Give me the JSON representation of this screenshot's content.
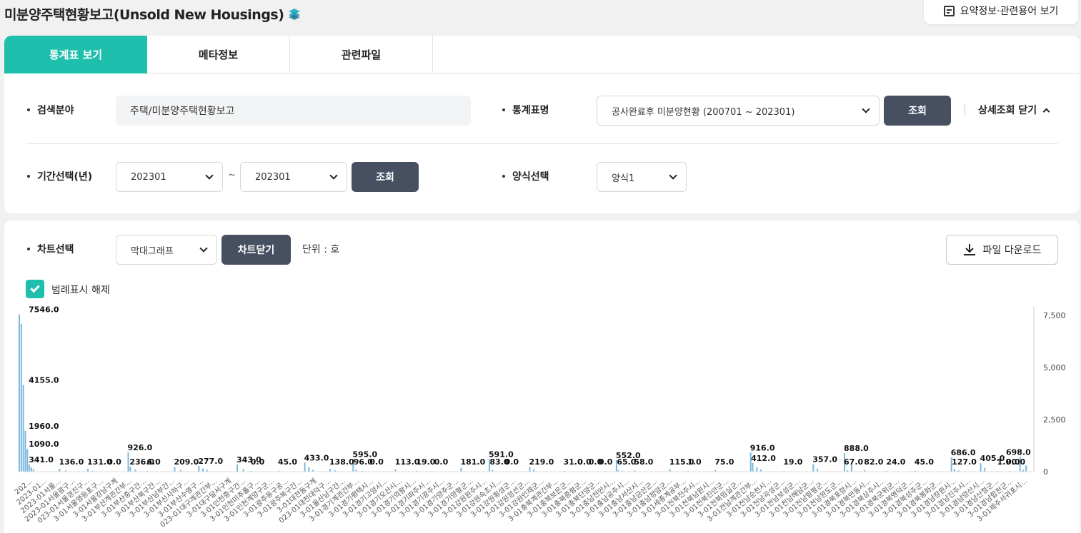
{
  "page": {
    "title": "미분양주택현황보고(Unsold New Housings)",
    "summary_button": "요약정보·관련용어 보기"
  },
  "tabs": [
    {
      "label": "통계표 보기",
      "active": true
    },
    {
      "label": "메타정보",
      "active": false
    },
    {
      "label": "관련파일",
      "active": false
    }
  ],
  "search": {
    "field_label": "검색분야",
    "field_value": "주택/미분양주택현황보고",
    "table_label": "통계표명",
    "table_value": "공사완료후 미분양현황 (200701 ~ 202301)",
    "query_button": "조회",
    "detail_toggle": "상세조회 닫기",
    "period_label": "기간선택(년)",
    "period_from": "202301",
    "period_sep": "~",
    "period_to": "202301",
    "period_query_button": "조회",
    "format_label": "양식선택",
    "format_value": "양식1"
  },
  "chart_controls": {
    "chart_label": "차트선택",
    "chart_type_value": "막대그래프",
    "close_chart_button": "차트닫기",
    "unit": "단위 : 호",
    "download_button": "파일 다운로드",
    "legend_checkbox_label": "범례표시 해제",
    "legend_checked": true
  },
  "colors": {
    "accent": "#1fbfad",
    "dark_button": "#475061",
    "bar": "#7ab8e0"
  },
  "chart_data": {
    "type": "bar",
    "y_ticks": [
      "7,500",
      "5,000",
      "2,500",
      "0"
    ],
    "ylim": [
      0,
      7500
    ],
    "y_axis_side": "right",
    "grid": false,
    "bar_labels": [
      {
        "x": 0.01,
        "text": "7546.0",
        "value": 7546
      },
      {
        "x": 0.01,
        "text": "4155.0",
        "value": 4155
      },
      {
        "x": 0.01,
        "text": "1960.0",
        "value": 1960
      },
      {
        "x": 0.01,
        "text": "1090.0",
        "value": 1090
      },
      {
        "x": 0.01,
        "text": "341.0",
        "value": 341
      },
      {
        "x": 0.04,
        "text": "136.0",
        "value": 136
      },
      {
        "x": 0.068,
        "text": "131.0",
        "value": 131
      },
      {
        "x": 0.088,
        "text": "0.0",
        "value": 0
      },
      {
        "x": 0.108,
        "text": "926.0",
        "value": 926
      },
      {
        "x": 0.11,
        "text": "236.0",
        "value": 236
      },
      {
        "x": 0.127,
        "text": "6.0",
        "value": 6
      },
      {
        "x": 0.154,
        "text": "209.0",
        "value": 209
      },
      {
        "x": 0.178,
        "text": "277.0",
        "value": 277
      },
      {
        "x": 0.216,
        "text": "343.0",
        "value": 343
      },
      {
        "x": 0.23,
        "text": "0.0",
        "value": 0
      },
      {
        "x": 0.257,
        "text": "45.0",
        "value": 45
      },
      {
        "x": 0.283,
        "text": "433.0",
        "value": 433
      },
      {
        "x": 0.308,
        "text": "138.0",
        "value": 138
      },
      {
        "x": 0.331,
        "text": "595.0",
        "value": 595
      },
      {
        "x": 0.332,
        "text": "96.0",
        "value": 96
      },
      {
        "x": 0.348,
        "text": "0.0",
        "value": 0
      },
      {
        "x": 0.373,
        "text": "113.0",
        "value": 113
      },
      {
        "x": 0.394,
        "text": "19.0",
        "value": 19
      },
      {
        "x": 0.412,
        "text": "0.0",
        "value": 0
      },
      {
        "x": 0.438,
        "text": "181.0",
        "value": 181
      },
      {
        "x": 0.466,
        "text": "591.0",
        "value": 591
      },
      {
        "x": 0.467,
        "text": "83.0",
        "value": 83
      },
      {
        "x": 0.482,
        "text": "0.0",
        "value": 0
      },
      {
        "x": 0.506,
        "text": "219.0",
        "value": 219
      },
      {
        "x": 0.54,
        "text": "31.0",
        "value": 31
      },
      {
        "x": 0.554,
        "text": "0.0",
        "value": 0
      },
      {
        "x": 0.565,
        "text": "0.0",
        "value": 0
      },
      {
        "x": 0.575,
        "text": "0.0",
        "value": 0
      },
      {
        "x": 0.592,
        "text": "552.0",
        "value": 552
      },
      {
        "x": 0.593,
        "text": "65.0",
        "value": 65
      },
      {
        "x": 0.61,
        "text": "58.0",
        "value": 58
      },
      {
        "x": 0.645,
        "text": "115.0",
        "value": 115
      },
      {
        "x": 0.663,
        "text": "1.0",
        "value": 1
      },
      {
        "x": 0.69,
        "text": "75.0",
        "value": 75
      },
      {
        "x": 0.725,
        "text": "916.0",
        "value": 916
      },
      {
        "x": 0.726,
        "text": "412.0",
        "value": 412
      },
      {
        "x": 0.758,
        "text": "19.0",
        "value": 19
      },
      {
        "x": 0.787,
        "text": "357.0",
        "value": 357
      },
      {
        "x": 0.818,
        "text": "888.0",
        "value": 888
      },
      {
        "x": 0.818,
        "text": "67.0",
        "value": 67
      },
      {
        "x": 0.838,
        "text": "82.0",
        "value": 82
      },
      {
        "x": 0.86,
        "text": "24.0",
        "value": 24
      },
      {
        "x": 0.888,
        "text": "45.0",
        "value": 45
      },
      {
        "x": 0.924,
        "text": "686.0",
        "value": 686
      },
      {
        "x": 0.925,
        "text": "127.0",
        "value": 127
      },
      {
        "x": 0.953,
        "text": "405.0",
        "value": 405
      },
      {
        "x": 0.97,
        "text": "1.0",
        "value": 1
      },
      {
        "x": 0.982,
        "text": "0.0",
        "value": 0
      },
      {
        "x": 0.999,
        "text": "698.0",
        "value": 698
      },
      {
        "x": 0.999,
        "text": "90.0",
        "value": 90
      }
    ],
    "bars": [
      [
        0.0,
        7546
      ],
      [
        0.002,
        7100
      ],
      [
        0.004,
        4155
      ],
      [
        0.006,
        1960
      ],
      [
        0.008,
        1090
      ],
      [
        0.01,
        341
      ],
      [
        0.012,
        200
      ],
      [
        0.014,
        120
      ],
      [
        0.04,
        136
      ],
      [
        0.046,
        60
      ],
      [
        0.068,
        131
      ],
      [
        0.073,
        40
      ],
      [
        0.108,
        926
      ],
      [
        0.11,
        236
      ],
      [
        0.115,
        110
      ],
      [
        0.127,
        6
      ],
      [
        0.154,
        209
      ],
      [
        0.16,
        80
      ],
      [
        0.178,
        277
      ],
      [
        0.182,
        150
      ],
      [
        0.186,
        90
      ],
      [
        0.216,
        343
      ],
      [
        0.222,
        120
      ],
      [
        0.23,
        0
      ],
      [
        0.257,
        45
      ],
      [
        0.283,
        433
      ],
      [
        0.287,
        210
      ],
      [
        0.291,
        90
      ],
      [
        0.308,
        138
      ],
      [
        0.313,
        60
      ],
      [
        0.331,
        595
      ],
      [
        0.334,
        96
      ],
      [
        0.34,
        40
      ],
      [
        0.373,
        113
      ],
      [
        0.394,
        19
      ],
      [
        0.438,
        181
      ],
      [
        0.466,
        591
      ],
      [
        0.469,
        83
      ],
      [
        0.506,
        219
      ],
      [
        0.51,
        110
      ],
      [
        0.54,
        31
      ],
      [
        0.592,
        552
      ],
      [
        0.594,
        65
      ],
      [
        0.598,
        40
      ],
      [
        0.61,
        58
      ],
      [
        0.645,
        115
      ],
      [
        0.663,
        1
      ],
      [
        0.69,
        75
      ],
      [
        0.725,
        916
      ],
      [
        0.727,
        412
      ],
      [
        0.731,
        220
      ],
      [
        0.735,
        110
      ],
      [
        0.758,
        19
      ],
      [
        0.787,
        357
      ],
      [
        0.791,
        140
      ],
      [
        0.818,
        888
      ],
      [
        0.821,
        67
      ],
      [
        0.825,
        340
      ],
      [
        0.838,
        82
      ],
      [
        0.86,
        24
      ],
      [
        0.888,
        45
      ],
      [
        0.924,
        686
      ],
      [
        0.927,
        127
      ],
      [
        0.931,
        60
      ],
      [
        0.953,
        405
      ],
      [
        0.957,
        180
      ],
      [
        0.97,
        1
      ],
      [
        0.982,
        0
      ],
      [
        0.992,
        698
      ],
      [
        0.995,
        90
      ],
      [
        0.998,
        300
      ]
    ],
    "x_tick_labels": [
      "202...",
      "2023-01...",
      "2023-01서울...",
      "2023-01서울광구...",
      "023-01서울경진구...",
      "3-01서울영등포구...",
      "3-01서울강남구계",
      "3-01부산계관간부...",
      "3-01부산중구간...",
      "3-01부산북구간...",
      "3-01부산남부간...",
      "3-01부산사하구...",
      "3-01부산수영구...",
      "023-01대구계관간부...",
      "3-01대구달서구계",
      "3-01인천중구간...",
      "3-01인천미추홀구...",
      "3-01인천계양구군...",
      "3-01광주동구공...",
      "3-01광주북구간...",
      "3-01대전동구계",
      "023-01대전대덕구...",
      "3-01울산남구간...",
      "3-01경기계관간부...",
      "3-01경기평택시...",
      "3-01경기고양시...",
      "3-01경기오산시...",
      "3-01경기의왕시...",
      "3-01경기파주시...",
      "3-01경기광주시...",
      "3-01경기양주군...",
      "3-01경기양평군...",
      "3-01강원원주시...",
      "3-01강원속초시...",
      "3-01강원횡성군...",
      "3-01강원정선군...",
      "3-01강원인제군...",
      "3-01충북계관간부...",
      "3-01충북보은군...",
      "3-01충북증평군...",
      "3-01충북단양군...",
      "3-01충남천안시...",
      "3-01충남공주시...",
      "3-01충남서산시...",
      "3-01충남금산군...",
      "3-01충남청양군...",
      "3-01세종계공부...",
      "3-01전북전주시...",
      "3-01전북남원시...",
      "3-01전북진안군...",
      "3-01전북임실군...",
      "3-01전남계관간부...",
      "3-01전남순천시...",
      "3-01전남곡성군...",
      "3-01전남보성군...",
      "3-01전남해남군...",
      "3-01전남함평군...",
      "3-01전남완도군...",
      "3-01경북포항시...",
      "3-01경북안동시...",
      "3-01경북상주시...",
      "3-01경북군위군...",
      "3-01경북영덕군...",
      "3-01경북성주군...",
      "3-01경북봉화군...",
      "3-01경남창원시...",
      "3-01경남진주시...",
      "3-01경남양산시...",
      "3-01경남산청군...",
      "3-01경남합천군...",
      "3-01제주서귀포시..."
    ]
  }
}
